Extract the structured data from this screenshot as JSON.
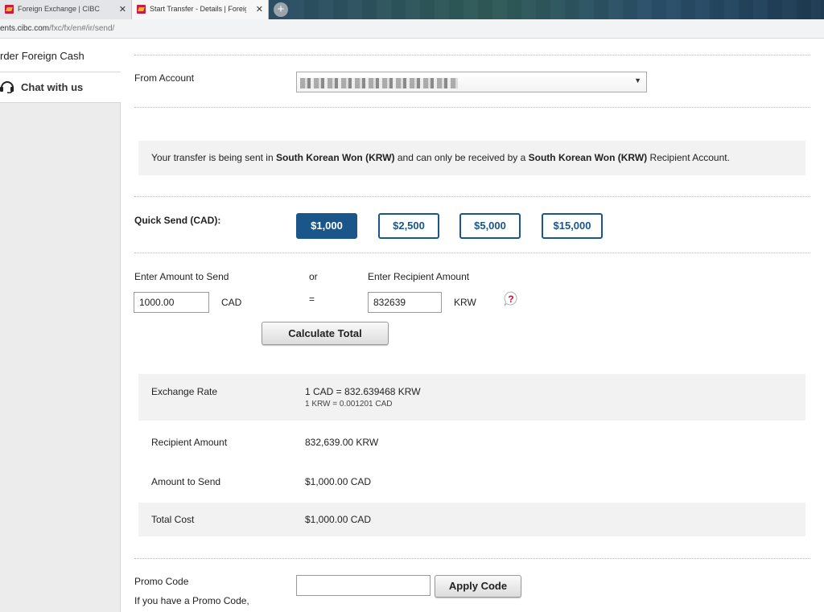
{
  "browser": {
    "tabs": [
      {
        "title": "Foreign Exchange | CIBC",
        "active": false
      },
      {
        "title": "Start Transfer - Details | Foreign E",
        "active": true
      }
    ],
    "url_host": "ents.cibc.com",
    "url_path": "/fxc/fx/en#/ir/send/"
  },
  "sidebar": {
    "order_label": "rder Foreign Cash",
    "chat_label": "Chat with us"
  },
  "from_account": {
    "label": "From Account",
    "selected_value": ""
  },
  "notice": {
    "part1": "Your transfer is being sent in ",
    "currency1": "South Korean Won (KRW)",
    "part2": " and can only be received by a ",
    "currency2": "South Korean Won (KRW)",
    "part3": " Recipient Account."
  },
  "quick_send": {
    "label": "Quick Send (CAD):",
    "options": [
      "$1,000",
      "$2,500",
      "$5,000",
      "$15,000"
    ],
    "selected": "$1,000"
  },
  "amounts": {
    "send_label": "Enter Amount to Send",
    "or_label": "or",
    "recipient_label": "Enter Recipient Amount",
    "send_value": "1000.00",
    "send_currency": "CAD",
    "equals": "=",
    "recipient_value": "832639",
    "recipient_currency": "KRW",
    "calculate_label": "Calculate Total"
  },
  "summary": {
    "exchange_rate_label": "Exchange Rate",
    "exchange_rate_value": "1 CAD = 832.639468 KRW",
    "exchange_rate_inverse": "1 KRW = 0.001201 CAD",
    "recipient_amount_label": "Recipient Amount",
    "recipient_amount_value": "832,639.00 KRW",
    "amount_to_send_label": "Amount to Send",
    "amount_to_send_value": "$1,000.00 CAD",
    "total_cost_label": "Total Cost",
    "total_cost_value": "$1,000.00 CAD"
  },
  "promo": {
    "label": "Promo Code",
    "hint": "If you have a Promo Code,",
    "input_value": "",
    "apply_label": "Apply Code"
  },
  "colors": {
    "primary_blue": "#1a5689",
    "help_red": "#c8102e"
  }
}
